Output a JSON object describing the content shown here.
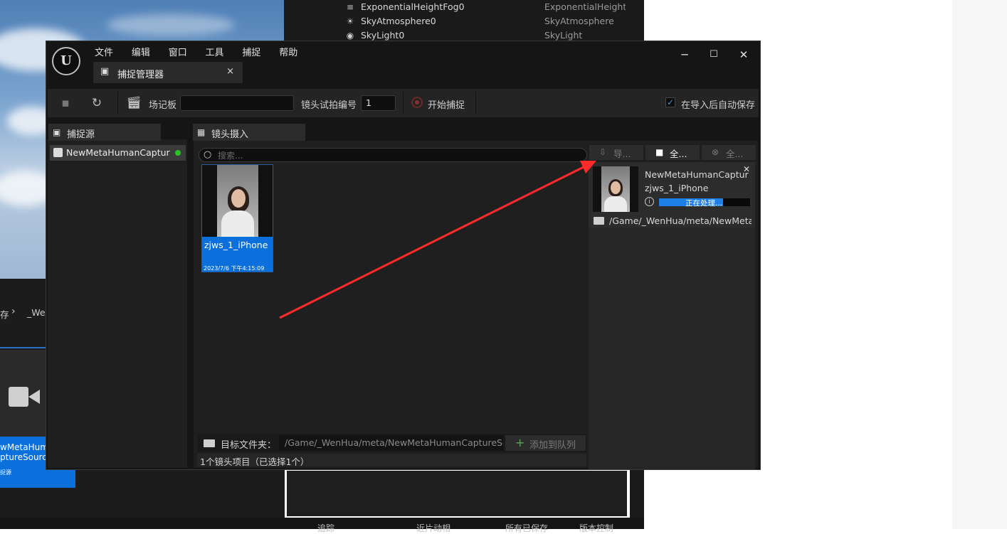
{
  "outliner": {
    "rows": [
      {
        "name": "ExponentialHeightFog0",
        "type": "ExponentialHeightFog"
      },
      {
        "name": "SkyAtmosphere0",
        "type": "SkyAtmosphere"
      },
      {
        "name": "SkyLight0",
        "type": "SkyLight"
      }
    ]
  },
  "content_browser": {
    "breadcrumb_left": "存",
    "breadcrumb_right": "_We",
    "asset_line1": "wMetaHuma",
    "asset_line2": "ptureSource",
    "asset_type": "捉源"
  },
  "bottom_status": {
    "items": [
      "追踪",
      "近片动相",
      "所有已保存",
      "版本控制"
    ]
  },
  "window": {
    "logo": "U",
    "menu": [
      "文件",
      "编辑",
      "窗口",
      "工具",
      "捕捉",
      "帮助"
    ],
    "tab_title": "捕捉管理器",
    "minimize": "─",
    "maximize": "☐",
    "close": "✕",
    "tab_close": "×"
  },
  "toolbar": {
    "slate_label": "场记板",
    "slate_value": "",
    "take_label": "镜头试拍编号",
    "take_value": "1",
    "start_capture": "开始捕捉",
    "auto_save_label": "在导入后自动保存",
    "auto_save_checked": true
  },
  "capture_source": {
    "tab": "捕捉源",
    "item": "NewMetaHumanCaptureSource",
    "status_color": "#27c327"
  },
  "footage": {
    "tab": "镜头摄入",
    "search_placeholder": "搜索...",
    "take_name": "zjws_1_iPhone",
    "take_date": "2023/7/6 下午4:15:09",
    "btn_import": "导...",
    "btn_select_all": "全...",
    "btn_clear_all": "全...",
    "target_folder_label": "目标文件夹：",
    "target_folder_path": "/Game/_WenHua/meta/NewMetaHumanCaptureSo",
    "add_to_queue": "添加到队列",
    "status_text": "1个镜头项目（已选择1个）"
  },
  "queue": {
    "source_name": "NewMetaHumanCaptureSource",
    "take_name": "zjws_1_iPhone",
    "progress_label": "正在处理...",
    "progress_fraction": 0.7,
    "path": "/Game/_WenHua/meta/NewMetaHumanCaptureSource"
  },
  "annotation": {
    "arrow_color": "#ff2a2a"
  }
}
